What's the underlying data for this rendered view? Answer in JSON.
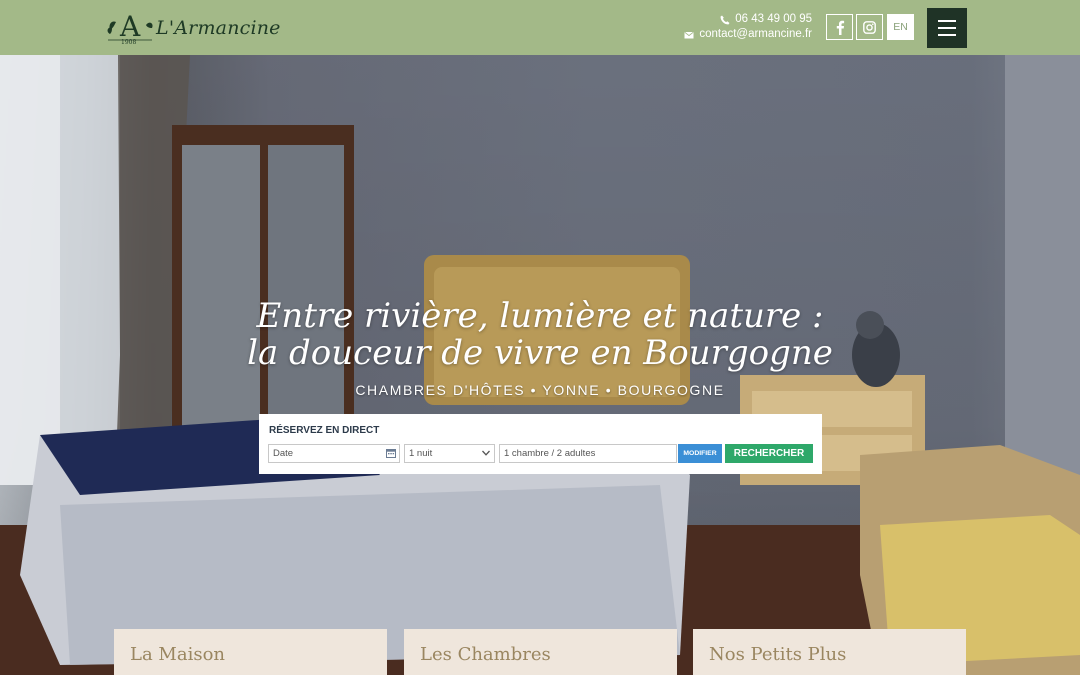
{
  "header": {
    "logo_text": "L'Armancine",
    "logo_letter": "A",
    "logo_year": "1908",
    "phone": "06 43 49 00 95",
    "email": "contact@armancine.fr",
    "lang": "EN",
    "colors": {
      "bar": "#a3b988",
      "menu": "#1f3326"
    }
  },
  "hero": {
    "headline_line1": "Entre rivière, lumière et nature :",
    "headline_line2": "la douceur de vivre en Bourgogne",
    "tagline": "CHAMBRES D'HÔTES • YONNE • BOURGOGNE"
  },
  "booking": {
    "title": "RÉSERVEZ EN DIRECT",
    "date_placeholder": "Date",
    "nights_value": "1 nuit",
    "rooms_value": "1 chambre / 2 adultes",
    "modify_label": "MODIFIER",
    "search_label": "RECHERCHER",
    "colors": {
      "modify": "#3b8fd6",
      "search": "#2ea86a"
    }
  },
  "cards": [
    {
      "label": "La Maison"
    },
    {
      "label": "Les Chambres"
    },
    {
      "label": "Nos Petits Plus"
    }
  ]
}
